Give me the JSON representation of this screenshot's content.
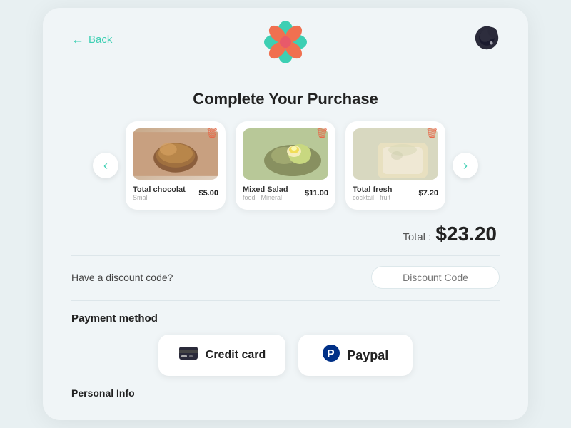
{
  "header": {
    "back_label": "Back",
    "title": "Complete Your Purchase",
    "dark_mode_label": "dark mode toggle"
  },
  "items": [
    {
      "name": "Total chocolat",
      "sub": "Small",
      "price": "$5.00",
      "img_class": "food-img-1",
      "img_alt": "chocolate dessert"
    },
    {
      "name": "Mixed Salad",
      "sub": "food · Mineral",
      "price": "$11.00",
      "img_class": "food-img-2",
      "img_alt": "mixed salad"
    },
    {
      "name": "Total fresh",
      "sub": "cocktail · fruit",
      "price": "$7.20",
      "img_class": "food-img-3",
      "img_alt": "fresh drink"
    }
  ],
  "total": {
    "label": "Total :",
    "amount": "$23.20"
  },
  "discount": {
    "question": "Have a discount code?",
    "placeholder": "Discount Code"
  },
  "payment": {
    "title": "Payment method",
    "methods": [
      {
        "label": "Credit card",
        "icon": "💳"
      },
      {
        "label": "Paypal",
        "icon": "🅿"
      }
    ]
  },
  "personal_info_label": "Personal Info",
  "carousel": {
    "prev": "‹",
    "next": "›"
  }
}
